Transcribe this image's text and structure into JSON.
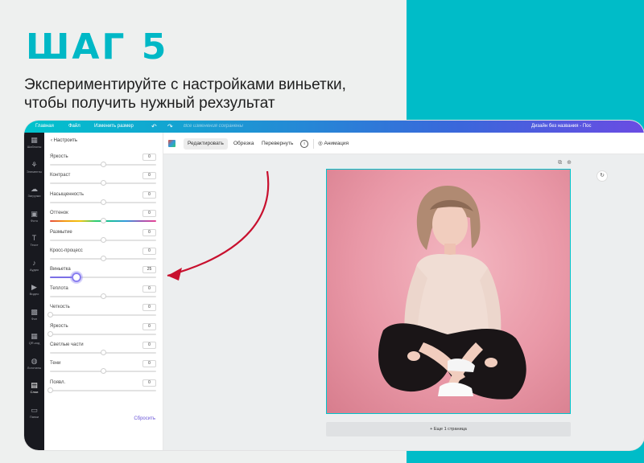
{
  "heading": {
    "step": "ШАГ 5",
    "line1": "Экспериментируйте с настройками виньетки,",
    "line2": "чтобы получить нужный рехзультат"
  },
  "topbar": {
    "home": "Главная",
    "file": "Файл",
    "resize": "Изменить размер",
    "undo_icon": "undo-icon",
    "redo_icon": "redo-icon",
    "saved_placeholder": "Все изменения сохранены",
    "design_title": "Дизайн без названия - Пос"
  },
  "sidebar": {
    "items": [
      {
        "label": "Шаблоны",
        "icon": "templates-icon"
      },
      {
        "label": "Элементы",
        "icon": "elements-icon"
      },
      {
        "label": "Загрузки",
        "icon": "upload-icon"
      },
      {
        "label": "Фото",
        "icon": "photo-icon"
      },
      {
        "label": "Текст",
        "icon": "text-icon"
      },
      {
        "label": "Аудио",
        "icon": "audio-icon"
      },
      {
        "label": "Видео",
        "icon": "video-icon"
      },
      {
        "label": "Фон",
        "icon": "background-icon"
      },
      {
        "label": "QR-код",
        "icon": "qr-code-icon"
      },
      {
        "label": "Логотипы",
        "icon": "logos-icon"
      },
      {
        "label": "Слои",
        "icon": "layers-icon"
      },
      {
        "label": "Папки",
        "icon": "folders-icon"
      }
    ]
  },
  "panel": {
    "back_label": "Настроить",
    "reset_label": "Сбросить",
    "adjustments": [
      {
        "name": "Яркость",
        "value": "0",
        "level": 0.5,
        "rainbow": false
      },
      {
        "name": "Контраст",
        "value": "0",
        "level": 0.5,
        "rainbow": false
      },
      {
        "name": "Насыщенность",
        "value": "0",
        "level": 0.5,
        "rainbow": false
      },
      {
        "name": "Оттенок",
        "value": "0",
        "level": 0.5,
        "rainbow": true
      },
      {
        "name": "Размытие",
        "value": "0",
        "level": 0.5,
        "rainbow": false
      },
      {
        "name": "Кросс-процесс",
        "value": "0",
        "level": 0.5,
        "rainbow": false
      },
      {
        "name": "Виньетка",
        "value": "25",
        "level": 0.25,
        "rainbow": false,
        "active": true
      },
      {
        "name": "Теплота",
        "value": "0",
        "level": 0.5,
        "rainbow": false
      },
      {
        "name": "Четкость",
        "value": "0",
        "level": 0.0,
        "rainbow": false
      },
      {
        "name": "Яркость",
        "value": "0",
        "level": 0.0,
        "rainbow": false
      },
      {
        "name": "Светлые части",
        "value": "0",
        "level": 0.5,
        "rainbow": false
      },
      {
        "name": "Тени",
        "value": "0",
        "level": 0.5,
        "rainbow": false
      },
      {
        "name": "Появл.",
        "value": "0",
        "level": 0.0,
        "rainbow": false
      }
    ]
  },
  "toolbar": {
    "edit": "Редактировать",
    "crop": "Обрезка",
    "flip": "Перевернуть",
    "info_icon": "info-icon",
    "animate": "Анимация"
  },
  "canvas": {
    "add_page": "+ Еще 1 страница"
  },
  "colors": {
    "accent_teal": "#00b8c6",
    "arrow_red": "#c8102e",
    "slider_purple": "#7b6fe6"
  }
}
